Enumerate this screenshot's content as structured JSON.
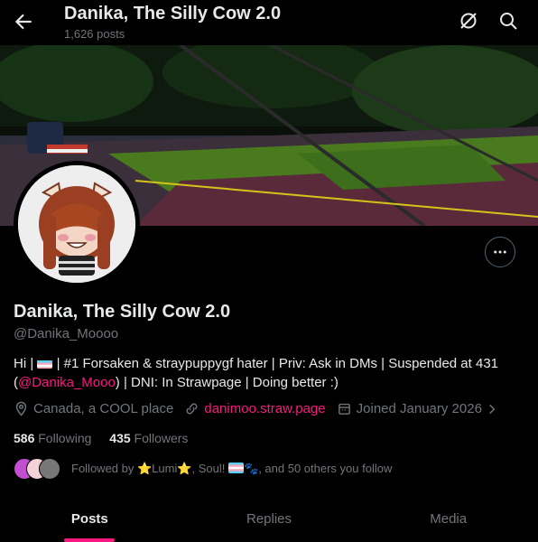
{
  "header": {
    "title": "Danika, The Silly Cow 2.0",
    "post_count": "1,626 posts"
  },
  "profile": {
    "name": "Danika, The Silly Cow 2.0",
    "handle": "@Danika_Moooo",
    "bio": {
      "part1": "Hi | ",
      "part2": " | #1 Forsaken & straypuppygf hater | Priv: Ask in DMs | Suspended at 431 (",
      "mention": "@Danika_Mooo",
      "part3": ") | DNI: In Strawpage | Doing better :)"
    },
    "location": "Canada, a COOL place",
    "website": "danimoo.straw.page",
    "joined": "Joined January 2026",
    "following_count": "586",
    "following_label": "Following",
    "followers_count": "435",
    "followers_label": "Followers",
    "followed_by": {
      "prefix": "Followed by ",
      "names": "⭐Lumi⭐, Soul! ",
      "suffix": "🐾, and 50 others you follow"
    }
  },
  "tabs": [
    {
      "label": "Posts",
      "active": true
    },
    {
      "label": "Replies",
      "active": false
    },
    {
      "label": "Media",
      "active": false
    }
  ],
  "icons": [
    "back-arrow-icon",
    "hide-icon",
    "search-icon",
    "more-icon",
    "location-icon",
    "link-icon",
    "calendar-icon",
    "chevron-right-icon"
  ],
  "colors": {
    "accent": "#f91880",
    "muted": "#71767b",
    "text": "#e7e9ea"
  }
}
